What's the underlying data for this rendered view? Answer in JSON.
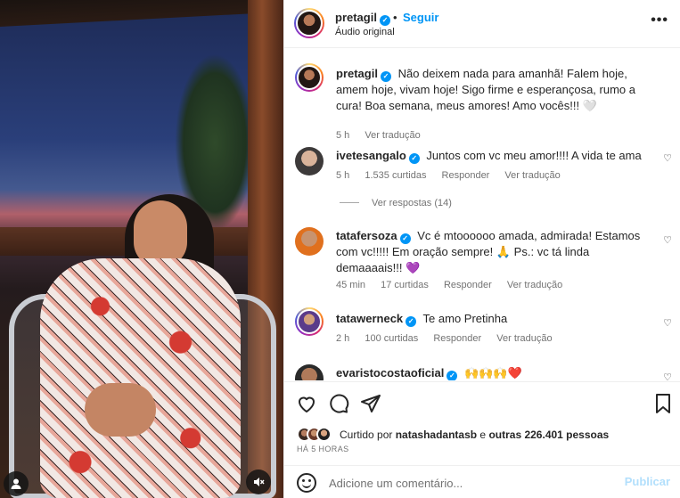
{
  "header": {
    "username": "pretagil",
    "follow_label": "Seguir",
    "separator": "•",
    "subtitle": "Áudio original",
    "more_label": "•••"
  },
  "caption": {
    "username": "pretagil",
    "text": "Não deixem nada para amanhã! Falem hoje, amem hoje, vivam hoje! Sigo firme e esperançosa, rumo a cura! Boa semana, meus amores! Amo vocês!!! 🤍",
    "time": "5 h",
    "translate": "Ver tradução"
  },
  "comments": [
    {
      "username": "ivetesangalo",
      "text": "Juntos com vc meu amor!!!! A vida te ama",
      "time": "5 h",
      "likes": "1.535 curtidas",
      "reply": "Responder",
      "translate": "Ver tradução",
      "replies": "Ver respostas (14)"
    },
    {
      "username": "tatafersoza",
      "text": "Vc é mtoooooo amada, admirada! Estamos com vc!!!!! Em oração sempre! 🙏 Ps.: vc tá linda demaaaais!!! 💜",
      "time": "45 min",
      "likes": "17 curtidas",
      "reply": "Responder",
      "translate": "Ver tradução"
    },
    {
      "username": "tatawerneck",
      "text": "Te amo Pretinha",
      "time": "2 h",
      "likes": "100 curtidas",
      "reply": "Responder",
      "translate": "Ver tradução"
    },
    {
      "username": "evaristocostaoficial",
      "text": "🙌🙌🙌❤️"
    }
  ],
  "likes": {
    "prefix": "Curtido por",
    "user": "natashadantasb",
    "connector": "e",
    "others": "outras 226.401 pessoas"
  },
  "time_ago": "HÁ 5 HORAS",
  "composer": {
    "placeholder": "Adicione um comentário...",
    "post_label": "Publicar"
  },
  "colors": {
    "accent": "#0095f6",
    "muted": "#737373",
    "heart_red": "#ed4956"
  },
  "icons": [
    "heart-icon",
    "comment-icon",
    "share-icon",
    "bookmark-icon",
    "mute-icon",
    "user-tag-icon",
    "emoji-icon",
    "verified-icon",
    "more-icon"
  ]
}
